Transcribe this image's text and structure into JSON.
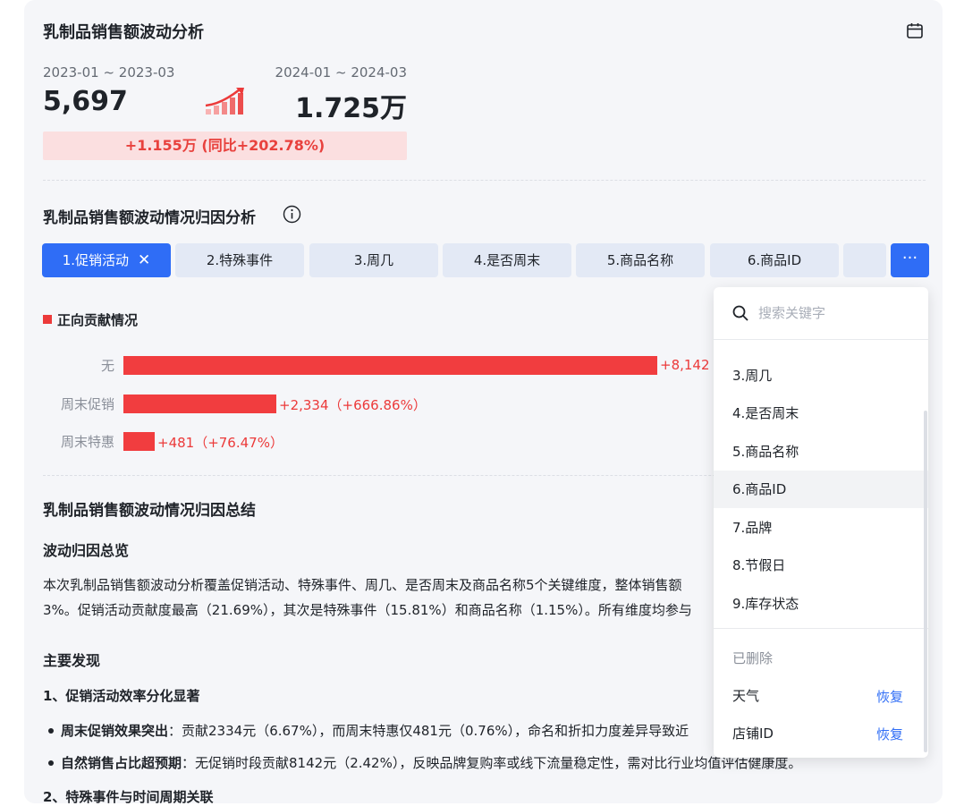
{
  "header": {
    "title": "乳制品销售额波动分析"
  },
  "comparison": {
    "period_a": "2023-01 ~ 2023-03",
    "value_a": "5,697",
    "period_b": "2024-01 ~ 2024-03",
    "value_b": "1.725万",
    "delta": "+1.155万 (同比+202.78%)"
  },
  "attribution": {
    "title": "乳制品销售额波动情况归因分析",
    "tabs": [
      {
        "label": "1.促销活动",
        "active": true
      },
      {
        "label": "2.特殊事件"
      },
      {
        "label": "3.周几"
      },
      {
        "label": "4.是否周末"
      },
      {
        "label": "5.商品名称"
      },
      {
        "label": "6.商品ID"
      },
      {
        "label": ""
      }
    ],
    "more_label": "···",
    "close_glyph": "✕"
  },
  "chart": {
    "legend": "正向贡献情况",
    "bar_color": "#f13d3f",
    "bars": [
      {
        "label": "无",
        "value": 8142,
        "display": "+8,142"
      },
      {
        "label": "周末促销",
        "value": 2334,
        "display": "+2,334（+666.86%）"
      },
      {
        "label": "周末特惠",
        "value": 481,
        "display": "+481（+76.47%）"
      }
    ]
  },
  "summary": {
    "title": "乳制品销售额波动情况归因总结",
    "overview_title": "波动归因总览",
    "overview_line1": "本次乳制品销售额波动分析覆盖促销活动、特殊事件、周几、是否周末及商品名称5个关键维度，整体销售额",
    "overview_line2": "3%。促销活动贡献度最高（21.69%），其次是特殊事件（15.81%）和商品名称（1.15%）。所有维度均参与",
    "findings_title": "主要发现",
    "finding1_title": "1、促销活动效率分化显著",
    "bullet1_lead": "周末促销效果突出",
    "bullet1_text": "：贡献2334元（6.67%），而周末特惠仅481元（0.76%），命名和折扣力度差异导致近",
    "bullet2_lead": "自然销售占比超预期",
    "bullet2_text": "：无促销时段贡献8142元（2.42%），反映品牌复购率或线下流量稳定性，需对比行业均值评估健康度。",
    "finding2_title": "2、特殊事件与时间周期关联"
  },
  "dropdown": {
    "search_placeholder": "搜索关键字",
    "items": [
      "3.周几",
      "4.是否周末",
      "5.商品名称",
      "6.商品ID",
      "7.品牌",
      "8.节假日",
      "9.库存状态"
    ],
    "deleted_title": "已删除",
    "deleted": [
      {
        "label": "天气",
        "action": "恢复"
      },
      {
        "label": "店铺ID",
        "action": "恢复"
      }
    ]
  }
}
